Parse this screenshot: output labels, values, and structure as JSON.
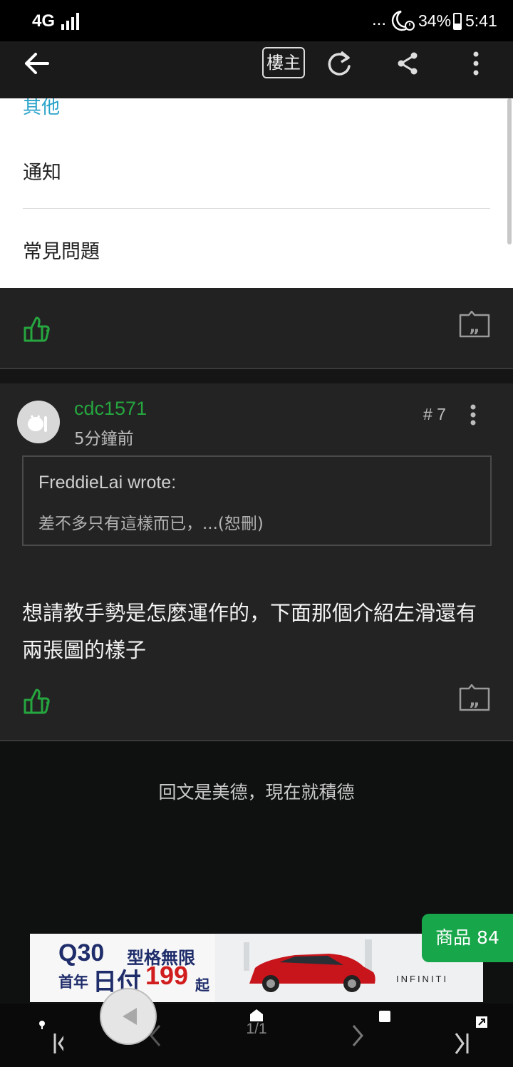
{
  "status_bar": {
    "network": "4G",
    "more": "...",
    "battery": "34%",
    "time": "5:41"
  },
  "toolbar": {
    "op_label": "樓主"
  },
  "menu": {
    "partial_label": "其他",
    "items": [
      "通知",
      "常見問題"
    ]
  },
  "post": {
    "username": "cdc1571",
    "time_ago": "5分鐘前",
    "floor": "# 7",
    "quote": {
      "author": "FreddieLai wrote:",
      "text": "差不多只有這樣而已，...(恕刪)"
    },
    "body": "想請教手勢是怎麼運作的，下面那個介紹左滑還有兩張圖的樣子"
  },
  "reply_hint": "回文是美德，現在就積德",
  "ad": {
    "model": "Q30",
    "slogan": "型格無限",
    "prefix": "首年",
    "daily": "日付",
    "price": "199",
    "suffix": "起",
    "brand": "INFINITI"
  },
  "products_button": "商品 84",
  "pagination": {
    "page": "1/1"
  },
  "colors": {
    "accent_green": "#26a63f",
    "products_green": "#17a64a",
    "link_blue": "#2aa3c9"
  }
}
